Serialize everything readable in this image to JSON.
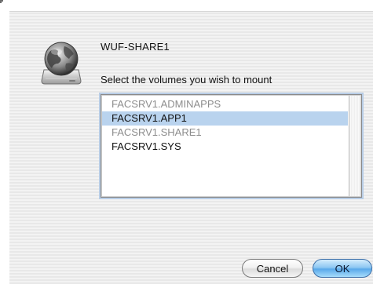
{
  "dialog": {
    "server_name": "WUF-SHARE1",
    "prompt": "Select the volumes you wish to mount",
    "icon": "network-server-globe-icon"
  },
  "volumes": [
    {
      "label": "FACSRV1.ADMINAPPS",
      "state": "disabled"
    },
    {
      "label": "FACSRV1.APP1",
      "state": "selected"
    },
    {
      "label": "FACSRV1.SHARE1",
      "state": "disabled"
    },
    {
      "label": "FACSRV1.SYS",
      "state": "normal"
    }
  ],
  "buttons": {
    "cancel_label": "Cancel",
    "ok_label": "OK"
  },
  "colors": {
    "selection": "#b9d3ee",
    "disabled_text": "#8d8d8d",
    "default_button": "#5aa9ea"
  }
}
